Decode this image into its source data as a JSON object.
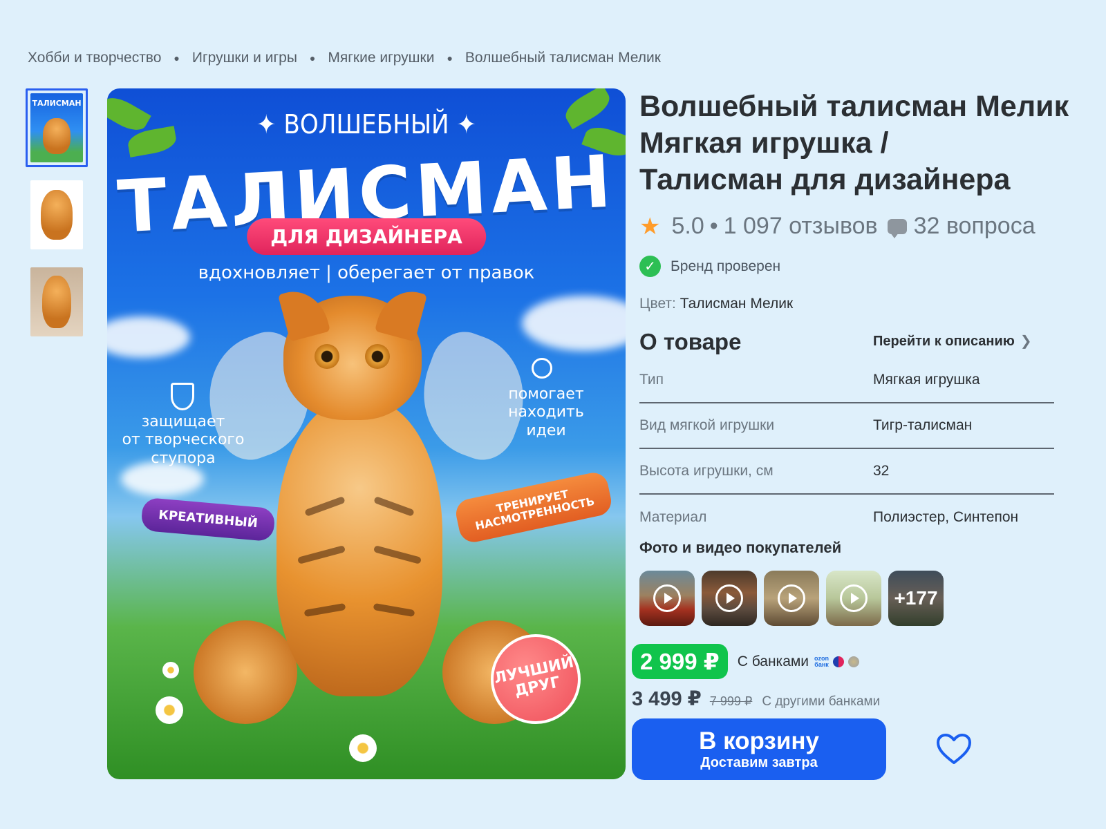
{
  "breadcrumbs": [
    "Хобби и творчество",
    "Игрушки и игры",
    "Мягкие игрушки",
    "Волшебный талисман Мелик"
  ],
  "hero": {
    "top_text": "✦ ВОЛШЕБНЫЙ ✦",
    "title": "ТАЛИСМАН",
    "pill": "ДЛЯ ДИЗАЙНЕРА",
    "tagline": "вдохновляет | оберегает от правок",
    "left_label": "защищает\nот творческого\nступора",
    "right_label": "помогает\nнаходить\nидеи",
    "tag_purple": "КРЕАТИВНЫЙ",
    "tag_orange": "ТРЕНИРУЕТ\nНАСМОТРЕННОСТЬ",
    "badge": "ЛУЧШИЙ\nДРУГ",
    "thumb_title": "ТАЛИСМАН"
  },
  "product": {
    "title_line1": "Волшебный талисман Мелик",
    "title_line2": "Мягкая игрушка /",
    "title_line3": "Талисман для дизайнера",
    "rating": "5.0",
    "reviews": "1 097 отзывов",
    "questions": "32 вопроса",
    "brand_verified": "Бренд проверен",
    "color_label": "Цвет:",
    "color_value": "Талисман Мелик"
  },
  "about": {
    "heading": "О товаре",
    "link": "Перейти к описанию",
    "specs": [
      {
        "k": "Тип",
        "v": "Мягкая игрушка"
      },
      {
        "k": "Вид мягкой игрушки",
        "v": "Тигр-талисман"
      },
      {
        "k": "Высота игрушки, см",
        "v": "32"
      },
      {
        "k": "Материал",
        "v": "Полиэстер, Синтепон"
      }
    ]
  },
  "photos": {
    "heading": "Фото и видео покупателей",
    "more": "+177"
  },
  "price": {
    "main": "2 999 ₽",
    "bank_label": "С банками",
    "ozon_label_1": "ozon",
    "ozon_label_2": "банк",
    "other": "3 499 ₽",
    "old": "7 999 ₽",
    "other_label": "С другими банками"
  },
  "cart": {
    "label": "В корзину",
    "sub": "Доставим завтра"
  },
  "colors": {
    "accent": "#1a5ff0",
    "price_green": "#10c44c",
    "star": "#ff9c2a",
    "verified": "#2dbf54"
  }
}
